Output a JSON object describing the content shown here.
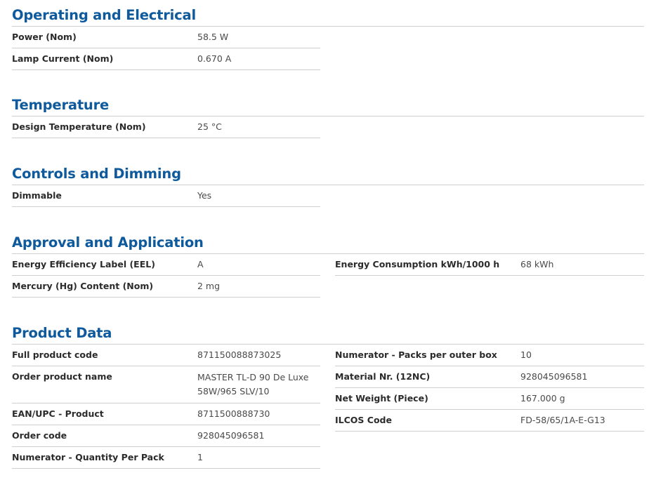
{
  "sections": [
    {
      "title": "Operating and Electrical",
      "left": [
        {
          "label": "Power (Nom)",
          "value": "58.5 W"
        },
        {
          "label": "Lamp Current (Nom)",
          "value": "0.670 A"
        }
      ],
      "right": []
    },
    {
      "title": "Temperature",
      "left": [
        {
          "label": "Design Temperature (Nom)",
          "value": "25 °C"
        }
      ],
      "right": []
    },
    {
      "title": "Controls and Dimming",
      "left": [
        {
          "label": "Dimmable",
          "value": "Yes"
        }
      ],
      "right": []
    },
    {
      "title": "Approval and Application",
      "left": [
        {
          "label": "Energy Efficiency Label (EEL)",
          "value": "A"
        },
        {
          "label": "Mercury (Hg) Content (Nom)",
          "value": "2 mg"
        }
      ],
      "right": [
        {
          "label": "Energy Consumption kWh/1000 h",
          "value": "68 kWh"
        }
      ]
    },
    {
      "title": "Product Data",
      "left": [
        {
          "label": "Full product code",
          "value": "871150088873025"
        },
        {
          "label": "Order product name",
          "value": "MASTER TL-D 90 De Luxe 58W/965 SLV/10"
        },
        {
          "label": "EAN/UPC - Product",
          "value": "8711500888730"
        },
        {
          "label": "Order code",
          "value": "928045096581"
        },
        {
          "label": "Numerator - Quantity Per Pack",
          "value": "1"
        }
      ],
      "right": [
        {
          "label": "Numerator - Packs per outer box",
          "value": "10"
        },
        {
          "label": "Material Nr. (12NC)",
          "value": "928045096581"
        },
        {
          "label": "Net Weight (Piece)",
          "value": "167.000 g"
        },
        {
          "label": "ILCOS Code",
          "value": "FD-58/65/1A-E-G13"
        }
      ]
    }
  ]
}
